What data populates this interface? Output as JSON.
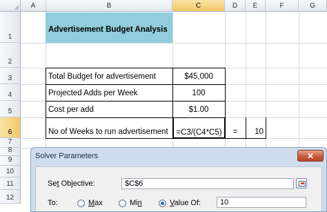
{
  "sheet": {
    "columns": [
      "A",
      "B",
      "C",
      "D",
      "E",
      "F",
      "G"
    ],
    "selected_column": "C",
    "rows": [
      "1",
      "2",
      "3",
      "4",
      "5",
      "6",
      "7",
      "8",
      "9",
      "10",
      "11",
      "12"
    ],
    "selected_row": "6",
    "title_fill": "#92cddc",
    "cells": {
      "b1": "Advertisement Budget Analysis",
      "b3": "Total Budget for advertisement",
      "c3": "$45,000",
      "b4": "Projected Adds per Week",
      "c4": "100",
      "b5": "Cost per add",
      "c5": "$1.00",
      "b6": "No of Weeks to run advertisement",
      "c6": "=C3/(C4*C5)",
      "d6": "=",
      "e6": "10"
    }
  },
  "solver": {
    "title": "Solver Parameters",
    "close_label": "✕",
    "objective_label_prefix": "Se",
    "objective_label_accel": "t",
    "objective_label_rest": " Objective:",
    "objective_value": "$C$6",
    "to_label": "To:",
    "max_label_accel": "M",
    "max_label_rest": "ax",
    "min_label_prefix": "Mi",
    "min_label_accel": "n",
    "value_of_label_accel": "V",
    "value_of_label_rest": "alue Of:",
    "value_of_value": "10",
    "selected_option": "value_of"
  }
}
